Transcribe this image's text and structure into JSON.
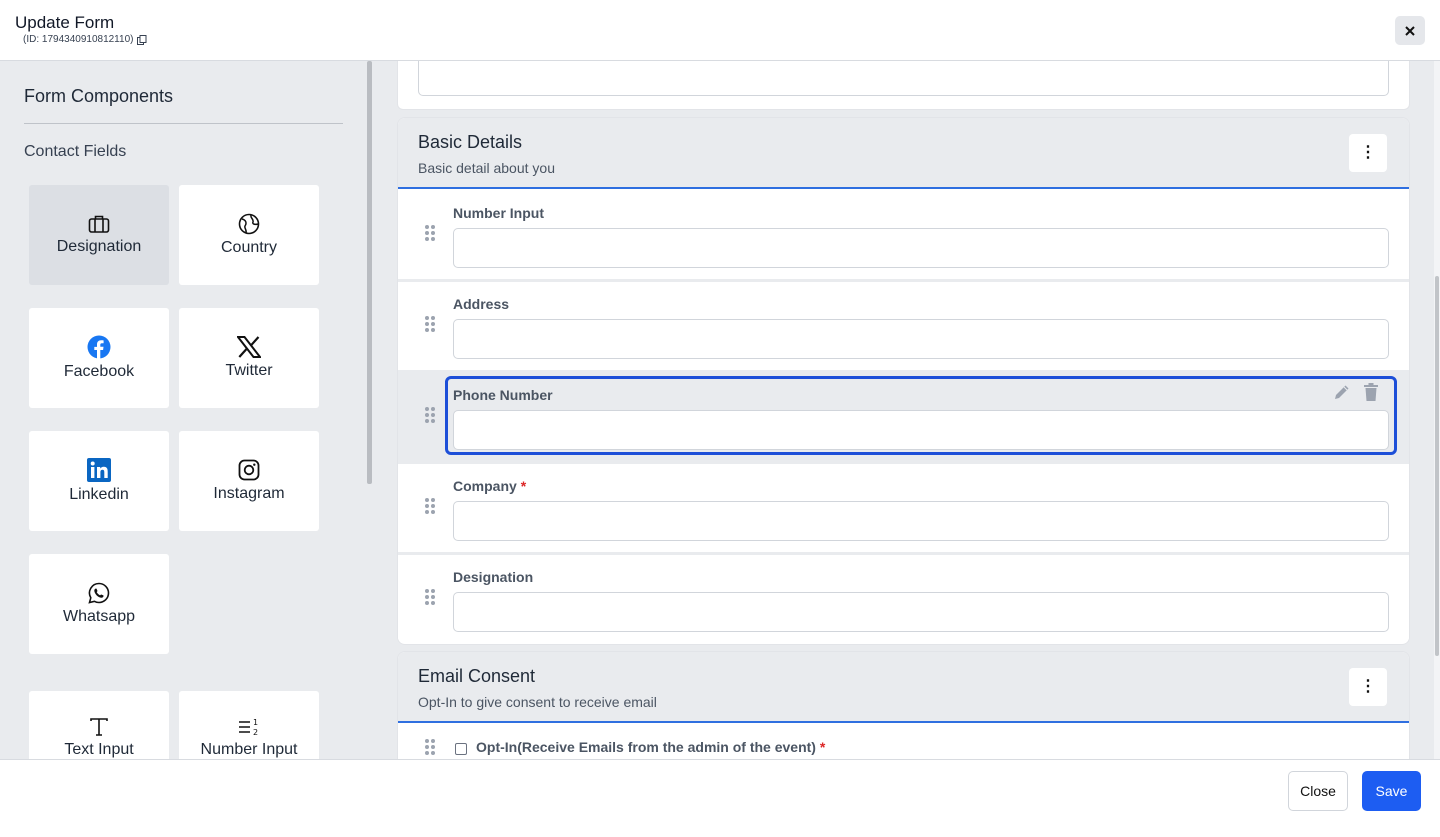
{
  "header": {
    "title": "Update Form",
    "id_text": "(ID: 1794340910812110)"
  },
  "sidebar": {
    "title": "Form Components",
    "subtitle": "Contact Fields",
    "tiles": [
      {
        "label": "Designation",
        "icon": "briefcase-icon",
        "active": true
      },
      {
        "label": "Country",
        "icon": "globe-icon"
      },
      {
        "label": "Facebook",
        "icon": "facebook-icon"
      },
      {
        "label": "Twitter",
        "icon": "x-twitter-icon"
      },
      {
        "label": "Linkedin",
        "icon": "linkedin-icon"
      },
      {
        "label": "Instagram",
        "icon": "instagram-icon"
      },
      {
        "label": "Whatsapp",
        "icon": "whatsapp-icon"
      },
      {
        "label": "Text Input",
        "icon": "text-icon"
      },
      {
        "label": "Number Input",
        "icon": "number-list-icon"
      }
    ]
  },
  "sections": {
    "basic": {
      "title": "Basic Details",
      "description": "Basic detail about you",
      "fields": [
        {
          "label": "Number Input",
          "required": false
        },
        {
          "label": "Address",
          "required": false
        },
        {
          "label": "Phone Number",
          "required": false,
          "selected": true
        },
        {
          "label": "Company",
          "required": true
        },
        {
          "label": "Designation",
          "required": false
        }
      ]
    },
    "email": {
      "title": "Email Consent",
      "description": "Opt-In to give consent to receive email",
      "optin_label": "Opt-In(Receive Emails from the admin of the event)",
      "required_mark": "*"
    }
  },
  "footer": {
    "close_label": "Close",
    "save_label": "Save"
  },
  "colors": {
    "accent": "#1d5df2",
    "selection": "#1d4fd8",
    "required": "#dc2626",
    "panel_bg": "#e9ebee"
  }
}
